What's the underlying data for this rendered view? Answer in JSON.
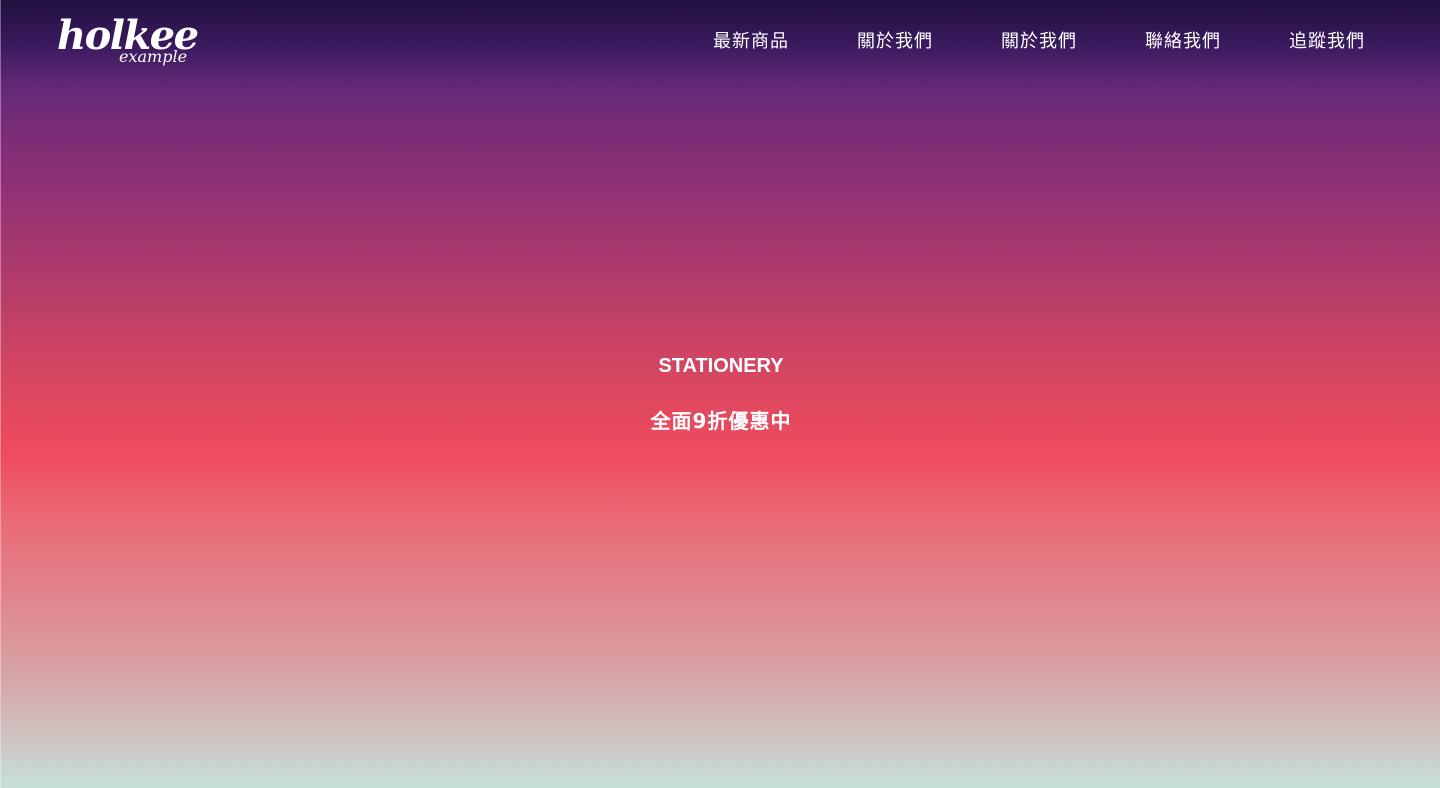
{
  "brand": {
    "name": "holkee",
    "tagline": "example"
  },
  "nav": {
    "items": [
      {
        "label": "最新商品"
      },
      {
        "label": "關於我們"
      },
      {
        "label": "關於我們"
      },
      {
        "label": "聯絡我們"
      },
      {
        "label": "追蹤我們"
      }
    ]
  },
  "hero": {
    "title": "STATIONERY",
    "subtitle": "全面9折優惠中"
  },
  "colors": {
    "gradient_top": "#20103f",
    "gradient_purple": "#672a78",
    "gradient_red": "#f04b5f",
    "gradient_bottom": "#c6e0d8",
    "text": "#ffffff"
  }
}
